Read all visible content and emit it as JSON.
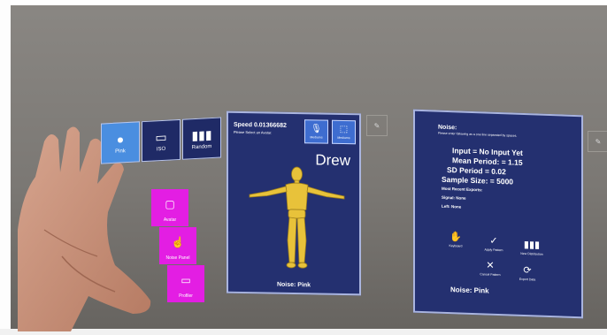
{
  "noise_selector": {
    "buttons": [
      {
        "label": "Pink",
        "icon": "circle-icon",
        "active": true
      },
      {
        "label": "ISO",
        "icon": "book-icon",
        "active": false
      },
      {
        "label": "Random",
        "icon": "bar-chart-icon",
        "active": false
      }
    ]
  },
  "side_buttons": [
    {
      "label": "Avatar",
      "icon": "cube-icon"
    },
    {
      "label": "Noise Panel",
      "icon": "hand-pointer-icon"
    },
    {
      "label": "Profiler",
      "icon": "book-icon"
    }
  ],
  "avatar_panel": {
    "speed": "Speed 0.01366682",
    "subtitle": "Please Select an Avatar.",
    "buttons": [
      {
        "label": "Mediums",
        "icon": "microphone-icon"
      },
      {
        "label": "Mediums",
        "icon": "cube-icon"
      }
    ],
    "avatar_name": "Drew",
    "noise_label": "Noise: Pink"
  },
  "stats_panel": {
    "title": "Noise:",
    "instructions": "Please enter following as a one line separated by spaces.",
    "input": "Input = No Input Yet",
    "mean_period": "Mean Period: = 1.15",
    "sd_period": "SD Period = 0.02",
    "sample_size": "Sample Size: = 5000",
    "recent_exports": "Most Recent Exports:",
    "signal": "Signal: None",
    "left": "Left: None",
    "actions": [
      {
        "label": "Keyboard",
        "icon": "hand-icon"
      },
      {
        "label": "Apply Pattern",
        "icon": "check-icon"
      },
      {
        "label": "New Distribution",
        "icon": "bar-chart-icon"
      },
      {
        "label": "Cancel Pattern",
        "icon": "close-icon"
      },
      {
        "label": "Export Data",
        "icon": "refresh-icon"
      }
    ],
    "noise_label": "Noise: Pink"
  },
  "colors": {
    "panel": "#243070",
    "active": "#4a8ee0",
    "magenta": "#e31ee3",
    "avatar": "#e8c23a"
  }
}
